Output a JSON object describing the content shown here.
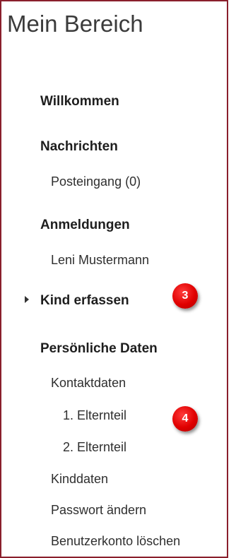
{
  "panel": {
    "title": "Mein Bereich"
  },
  "nav": {
    "welcome": "Willkommen",
    "messages": "Nachrichten",
    "inbox": "Posteingang (0)",
    "registrations": "Anmeldungen",
    "child_name": "Leni Mustermann",
    "add_child": "Kind erfassen",
    "personal_data": "Persönliche Daten",
    "contact_data": "Kontaktdaten",
    "parent1": "1. Elternteil",
    "parent2": "2. Elternteil",
    "child_data": "Kinddaten",
    "change_password": "Passwort ändern",
    "delete_account": "Benutzerkonto löschen"
  },
  "annotations": {
    "badge3": "3",
    "badge4": "4",
    "badge_color": "#e00000"
  },
  "icons": {
    "expand_marker": "caret-right-icon"
  }
}
